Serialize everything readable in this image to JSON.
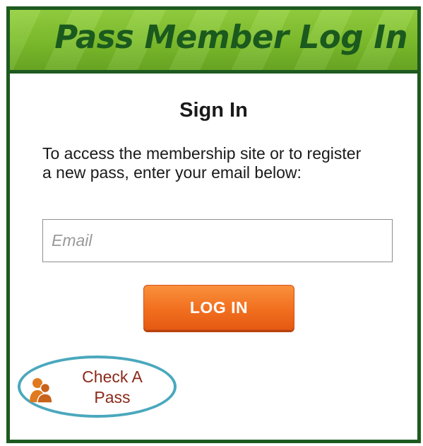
{
  "banner": {
    "title": "Pass Member Log In"
  },
  "signin": {
    "title": "Sign In",
    "intro": "To access the membership site or to register a new pass, enter your email below:",
    "email_placeholder": "Email",
    "email_value": "",
    "login_label": "LOG IN"
  },
  "check_pass": {
    "label_line1": "Check A",
    "label_line2": "Pass",
    "icon": "person-icon"
  },
  "colors": {
    "frame": "#1d5a1f",
    "banner_green": "#7dbd2c",
    "button_orange": "#f16f1f",
    "highlight_ring": "#4aa8bd",
    "link_text": "#8a2a1a"
  }
}
